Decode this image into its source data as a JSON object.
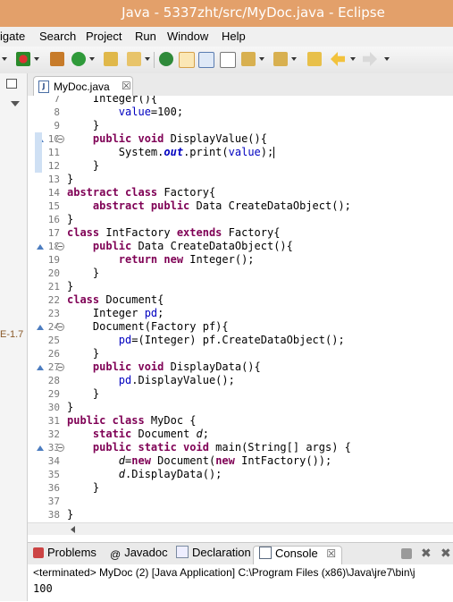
{
  "window": {
    "title": "Java - 5337zht/src/MyDoc.java - Eclipse"
  },
  "menu": {
    "items": [
      "igate",
      "Search",
      "Project",
      "Run",
      "Window",
      "Help"
    ]
  },
  "left_panel": {
    "jre_label": "E-1.7"
  },
  "editor": {
    "tab_label": "MyDoc.java",
    "tab_close": "☒",
    "lines": [
      {
        "num": "7",
        "tokens": [
          [
            "t",
            "    Integer(){"
          ]
        ]
      },
      {
        "num": "8",
        "tokens": [
          [
            "t",
            "        "
          ],
          [
            "fld",
            "value"
          ],
          [
            "t",
            "=100;"
          ]
        ]
      },
      {
        "num": "9",
        "tokens": [
          [
            "t",
            "    }"
          ]
        ]
      },
      {
        "num": "10",
        "tokens": [
          [
            "t",
            "    "
          ],
          [
            "kw",
            "public void"
          ],
          [
            "t",
            " DisplayValue(){"
          ]
        ]
      },
      {
        "num": "11",
        "tokens": [
          [
            "t",
            "        System."
          ],
          [
            "sfld",
            "out"
          ],
          [
            "t",
            ".print("
          ],
          [
            "fld",
            "value"
          ],
          [
            "t",
            ");"
          ]
        ]
      },
      {
        "num": "12",
        "tokens": [
          [
            "t",
            "    }"
          ]
        ]
      },
      {
        "num": "13",
        "tokens": [
          [
            "t",
            "}"
          ]
        ]
      },
      {
        "num": "14",
        "tokens": [
          [
            "kw",
            "abstract class"
          ],
          [
            "t",
            " Factory{"
          ]
        ]
      },
      {
        "num": "15",
        "tokens": [
          [
            "t",
            "    "
          ],
          [
            "kw",
            "abstract public"
          ],
          [
            "t",
            " Data CreateDataObject();"
          ]
        ]
      },
      {
        "num": "16",
        "tokens": [
          [
            "t",
            "}"
          ]
        ]
      },
      {
        "num": "17",
        "tokens": [
          [
            "kw",
            "class"
          ],
          [
            "t",
            " IntFactory "
          ],
          [
            "kw",
            "extends"
          ],
          [
            "t",
            " Factory{"
          ]
        ]
      },
      {
        "num": "18",
        "tokens": [
          [
            "t",
            "    "
          ],
          [
            "kw",
            "public"
          ],
          [
            "t",
            " Data CreateDataObject(){"
          ]
        ]
      },
      {
        "num": "19",
        "tokens": [
          [
            "t",
            "        "
          ],
          [
            "kw",
            "return new"
          ],
          [
            "t",
            " Integer();"
          ]
        ]
      },
      {
        "num": "20",
        "tokens": [
          [
            "t",
            "    }"
          ]
        ]
      },
      {
        "num": "21",
        "tokens": [
          [
            "t",
            "}"
          ]
        ]
      },
      {
        "num": "22",
        "tokens": [
          [
            "kw",
            "class"
          ],
          [
            "t",
            " Document{"
          ]
        ]
      },
      {
        "num": "23",
        "tokens": [
          [
            "t",
            "    Integer "
          ],
          [
            "fld",
            "pd"
          ],
          [
            "t",
            ";"
          ]
        ]
      },
      {
        "num": "24",
        "tokens": [
          [
            "t",
            "    Document(Factory "
          ],
          [
            "var",
            "pf"
          ],
          [
            "t",
            "){"
          ]
        ]
      },
      {
        "num": "25",
        "tokens": [
          [
            "t",
            "        "
          ],
          [
            "fld",
            "pd"
          ],
          [
            "t",
            "=(Integer) "
          ],
          [
            "var",
            "pf"
          ],
          [
            "t",
            ".CreateDataObject();"
          ]
        ]
      },
      {
        "num": "26",
        "tokens": [
          [
            "t",
            "    }"
          ]
        ]
      },
      {
        "num": "27",
        "tokens": [
          [
            "t",
            "    "
          ],
          [
            "kw",
            "public void"
          ],
          [
            "t",
            " DisplayData(){"
          ]
        ]
      },
      {
        "num": "28",
        "tokens": [
          [
            "t",
            "        "
          ],
          [
            "fld",
            "pd"
          ],
          [
            "t",
            ".DisplayValue();"
          ]
        ]
      },
      {
        "num": "29",
        "tokens": [
          [
            "t",
            "    }"
          ]
        ]
      },
      {
        "num": "30",
        "tokens": [
          [
            "t",
            "}"
          ]
        ]
      },
      {
        "num": "31",
        "tokens": [
          [
            "kw",
            "public class"
          ],
          [
            "t",
            " MyDoc {"
          ]
        ]
      },
      {
        "num": "32",
        "tokens": [
          [
            "t",
            "    "
          ],
          [
            "kw",
            "static"
          ],
          [
            "t",
            " Document "
          ],
          [
            "sitl",
            "d"
          ],
          [
            "t",
            ";"
          ]
        ]
      },
      {
        "num": "33",
        "tokens": [
          [
            "t",
            "    "
          ],
          [
            "kw",
            "public static void"
          ],
          [
            "t",
            " main(String[] "
          ],
          [
            "var",
            "args"
          ],
          [
            "t",
            ") {"
          ]
        ]
      },
      {
        "num": "34",
        "tokens": [
          [
            "t",
            "        "
          ],
          [
            "sitl",
            "d"
          ],
          [
            "t",
            "="
          ],
          [
            "kw",
            "new"
          ],
          [
            "t",
            " Document("
          ],
          [
            "kw",
            "new"
          ],
          [
            "t",
            " IntFactory());"
          ]
        ]
      },
      {
        "num": "35",
        "tokens": [
          [
            "t",
            "        "
          ],
          [
            "sitl",
            "d"
          ],
          [
            "t",
            ".DisplayData();"
          ]
        ]
      },
      {
        "num": "36",
        "tokens": [
          [
            "t",
            "    }"
          ]
        ]
      },
      {
        "num": "37",
        "tokens": [
          [
            "t",
            ""
          ]
        ]
      },
      {
        "num": "38",
        "tokens": [
          [
            "t",
            "}"
          ]
        ]
      }
    ]
  },
  "views": {
    "tabs": [
      "Problems",
      "Javadoc",
      "Declaration",
      "Console"
    ],
    "active": "Console",
    "close": "☒"
  },
  "console": {
    "terminated": "<terminated> MyDoc (2) [Java Application] C:\\Program Files (x86)\\Java\\jre7\\bin\\j",
    "output": "100"
  },
  "colors": {
    "title_bar": "#e3a06a",
    "keyword": "#7f0055",
    "field": "#0000c0"
  }
}
